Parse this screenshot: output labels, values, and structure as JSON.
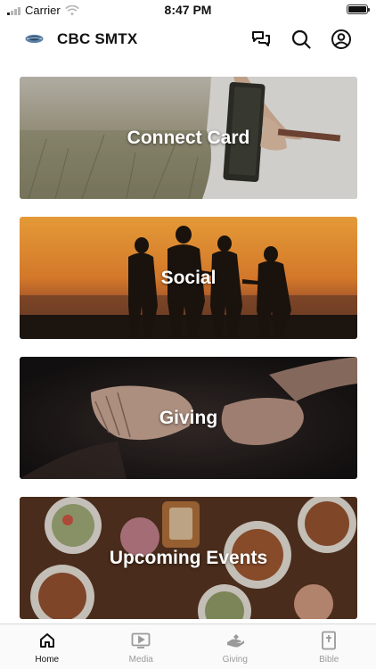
{
  "status_bar": {
    "carrier": "Carrier",
    "time": "8:47 PM"
  },
  "header": {
    "title": "CBC SMTX",
    "icons": [
      "chat-icon",
      "search-icon",
      "profile-icon"
    ]
  },
  "cards": [
    {
      "label": "Connect Card",
      "image": "field-with-bible-photo"
    },
    {
      "label": "Social",
      "image": "sunset-silhouettes-photo"
    },
    {
      "label": "Giving",
      "image": "open-hands-photo"
    },
    {
      "label": "Upcoming Events",
      "image": "food-table-photo"
    }
  ],
  "tabs": [
    {
      "label": "Home",
      "icon": "home-icon",
      "active": true
    },
    {
      "label": "Media",
      "icon": "media-icon",
      "active": false
    },
    {
      "label": "Giving",
      "icon": "giving-icon",
      "active": false
    },
    {
      "label": "Bible",
      "icon": "bible-icon",
      "active": false
    }
  ],
  "colors": {
    "active_tab": "#111111",
    "inactive_tab": "#9a9a9a",
    "header_text": "#111111"
  }
}
